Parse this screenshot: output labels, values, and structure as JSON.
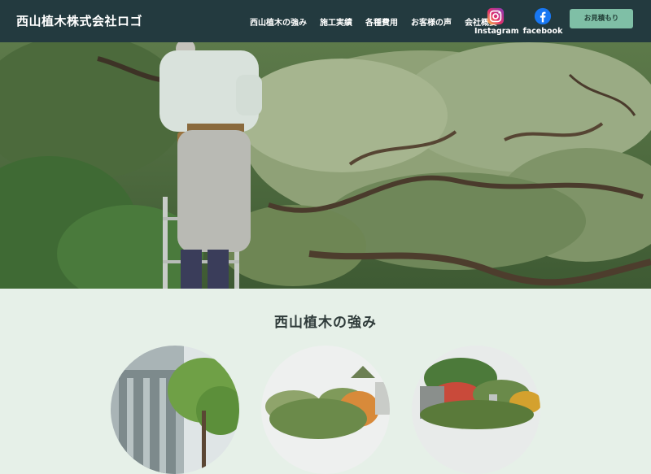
{
  "header": {
    "logo": "西山植木株式会社ロゴ",
    "nav": [
      "西山植木の強み",
      "施工実績",
      "各種費用",
      "お客様の声",
      "会社概要"
    ],
    "social": [
      {
        "label": "Instagram",
        "icon": "instagram-icon"
      },
      {
        "label": "facebook",
        "icon": "facebook-icon"
      }
    ],
    "cta_label": "お見積もり"
  },
  "hero": {
    "image": "gardener-pruning-pine-tree-photo"
  },
  "strengths": {
    "title": "西山植木の強み",
    "images": [
      "modern-building-with-trees-photo",
      "autumn-garden-trees-photo",
      "rock-garden-azaleas-photo"
    ]
  },
  "colors": {
    "header_bg": "#233a3f",
    "cta_bg": "#7fbfa6",
    "section_bg": "#e6f0e8"
  }
}
